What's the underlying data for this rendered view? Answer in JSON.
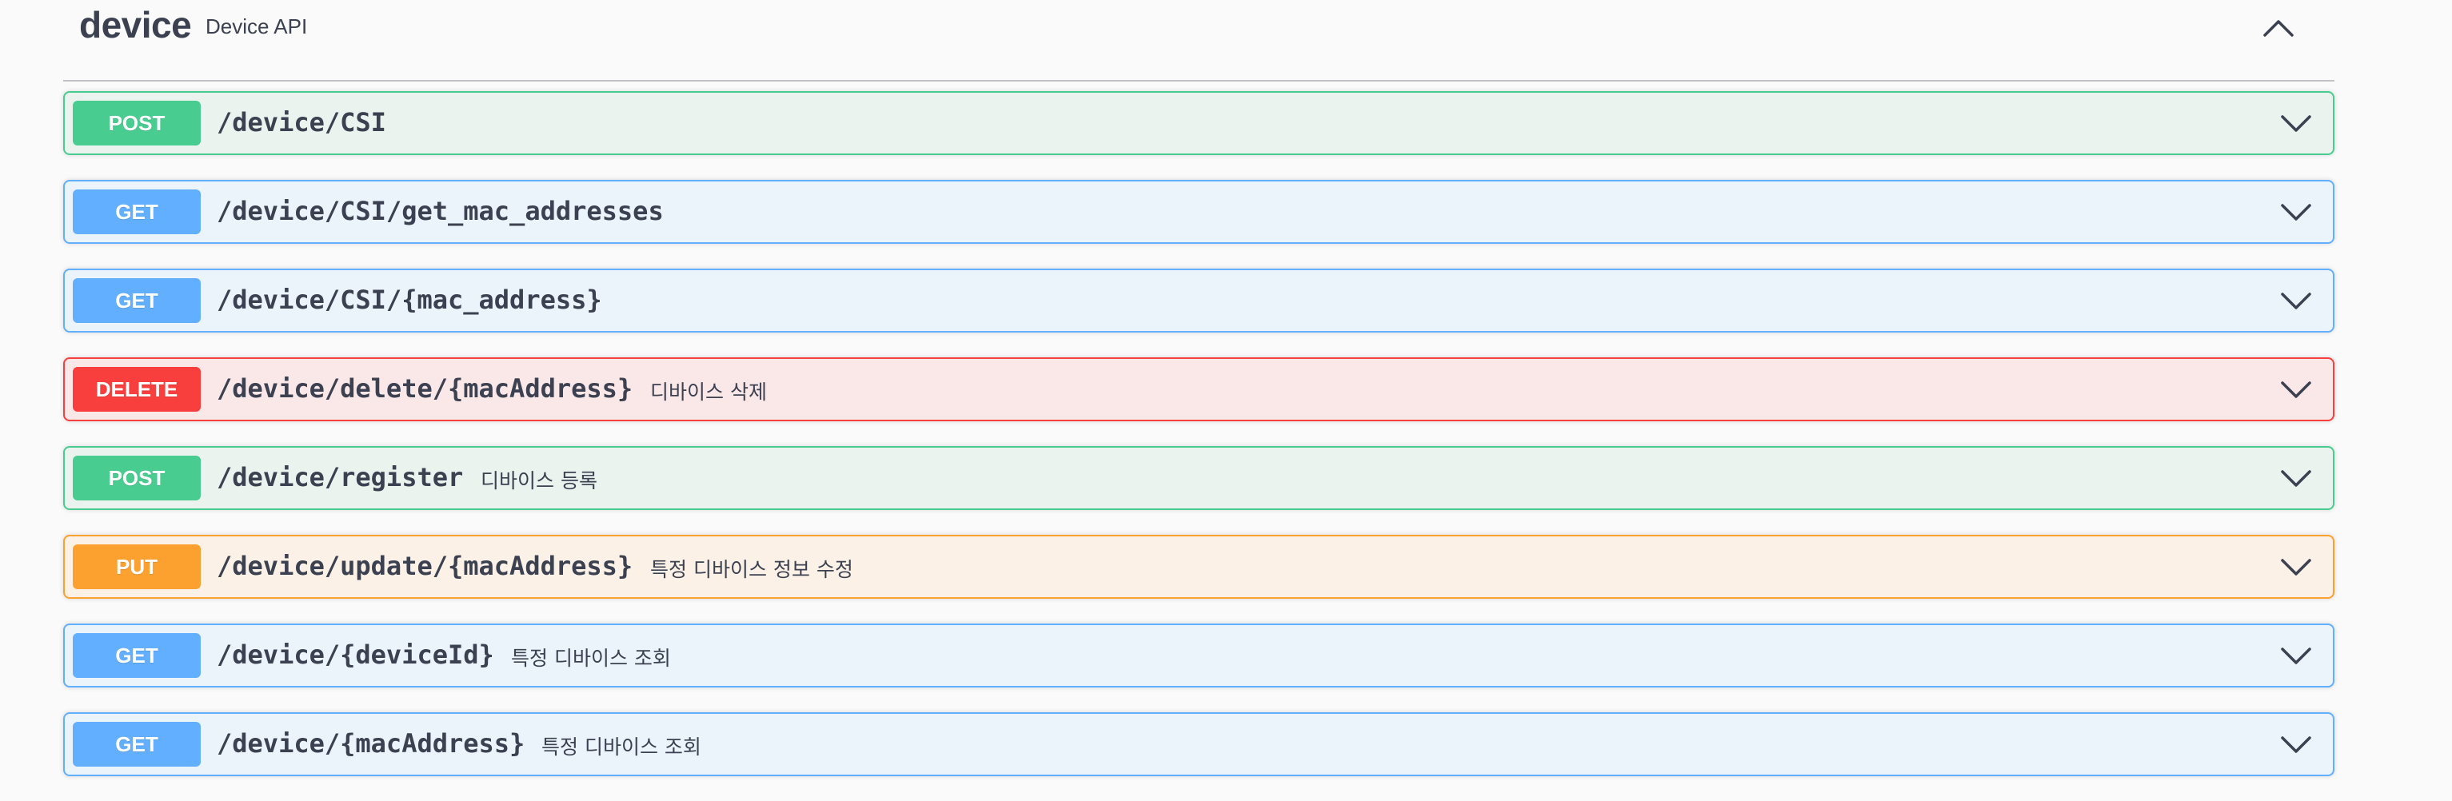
{
  "tag": {
    "name": "device",
    "description": "Device API",
    "collapse_icon": "chevron-up-icon"
  },
  "colors": {
    "post": "#49cc90",
    "get": "#61affe",
    "delete": "#f93e3e",
    "put": "#fca130",
    "text": "#3b4151"
  },
  "operations": [
    {
      "method": "POST",
      "path": "/device/CSI",
      "summary": "",
      "icon": "chevron-down-icon"
    },
    {
      "method": "GET",
      "path": "/device/CSI/get_mac_addresses",
      "summary": "",
      "icon": "chevron-down-icon"
    },
    {
      "method": "GET",
      "path": "/device/CSI/{mac_address}",
      "summary": "",
      "icon": "chevron-down-icon"
    },
    {
      "method": "DELETE",
      "path": "/device/delete/{macAddress}",
      "summary": "디바이스 삭제",
      "icon": "chevron-down-icon"
    },
    {
      "method": "POST",
      "path": "/device/register",
      "summary": "디바이스 등록",
      "icon": "chevron-down-icon"
    },
    {
      "method": "PUT",
      "path": "/device/update/{macAddress}",
      "summary": "특정 디바이스 정보 수정",
      "icon": "chevron-down-icon"
    },
    {
      "method": "GET",
      "path": "/device/{deviceId}",
      "summary": "특정 디바이스 조회",
      "icon": "chevron-down-icon"
    },
    {
      "method": "GET",
      "path": "/device/{macAddress}",
      "summary": "특정 디바이스 조회",
      "icon": "chevron-down-icon"
    }
  ]
}
